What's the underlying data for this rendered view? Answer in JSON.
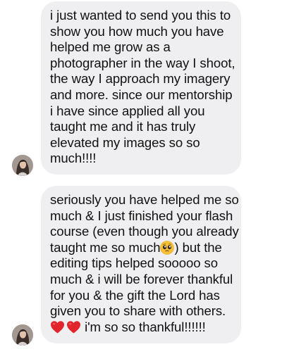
{
  "thread": {
    "messages": [
      {
        "lines": [
          "i just wanted to send you this to",
          "show you how much you have",
          "helped me grow as a",
          "photographer in the way I shoot,",
          "the way I approach my imagery",
          "and more. since our mentorship",
          "i have since applied all you",
          "taught me and it has truly",
          "elevated my images so so",
          "much!!!!"
        ]
      },
      {
        "lines": [
          "seriously you have helped me so",
          "much & I just finished your flash",
          "course (even though you already",
          "taught me so much",
          ") but the",
          "editing tips helped sooooo so",
          "much & i will be forever thankful",
          "for you & the gift the Lord has",
          "given you to share with others.",
          " i'm so so thankful!!!!!!"
        ],
        "emojis": [
          "pleading-face-emoji",
          "red-heart-emoji",
          "red-heart-emoji"
        ]
      }
    ]
  },
  "colors": {
    "bubble_background": "#efeff1",
    "text": "#111111",
    "heart": "#e0252c",
    "emoji_face": "#f7c136"
  }
}
